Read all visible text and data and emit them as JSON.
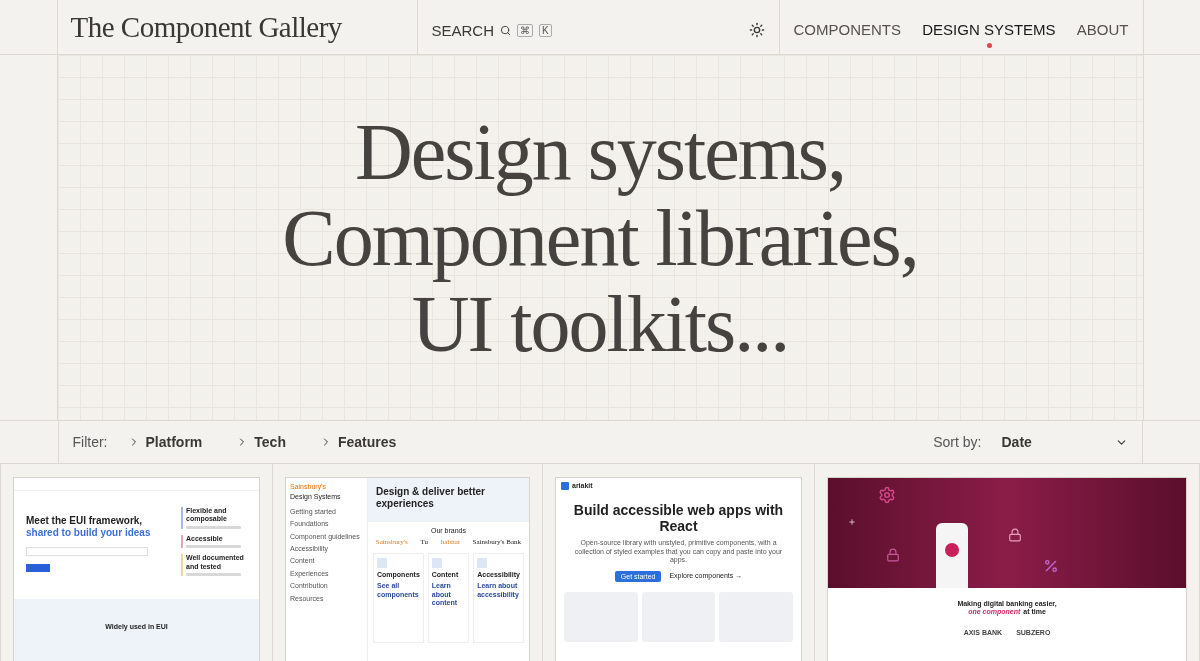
{
  "header": {
    "logo": "The Component Gallery",
    "search": {
      "label": "SEARCH",
      "keys": [
        "⌘",
        "K"
      ]
    },
    "nav": [
      {
        "label": "COMPONENTS",
        "selected": false
      },
      {
        "label": "DESIGN SYSTEMS",
        "selected": true
      },
      {
        "label": "ABOUT",
        "selected": false
      }
    ]
  },
  "hero": {
    "lines": [
      "Design systems,",
      "Component libraries,",
      "UI toolkits..."
    ]
  },
  "filter": {
    "label": "Filter:",
    "options": [
      "Platform",
      "Tech",
      "Features"
    ],
    "sort_label": "Sort by:",
    "sort_value": "Date"
  },
  "cards": [
    {
      "kind": "eui",
      "heading": "Meet the EUI framework,",
      "accent": "shared to build your ideas",
      "features": [
        "Flexible and composable",
        "Accessible",
        "Well documented and tested"
      ],
      "section": "Widely used in EUI"
    },
    {
      "kind": "sainsbury",
      "brand": "Sainsbury's",
      "brand_rest": "Design Systems",
      "nav": [
        "Getting started",
        "Foundations",
        "Component guidelines",
        "Accessibility",
        "Content",
        "Experiences",
        "Contribution",
        "Resources"
      ],
      "heading": "Design & deliver better experiences",
      "brands_title": "Our brands",
      "brands": [
        "Sainsbury's",
        "Tu",
        "habitat",
        "Sainsbury's Bank"
      ],
      "tiles": [
        {
          "title": "Components",
          "link": "See all components"
        },
        {
          "title": "Content",
          "link": "Learn about content"
        },
        {
          "title": "Accessibility",
          "link": "Learn about accessibility"
        }
      ]
    },
    {
      "kind": "ariakit",
      "logo": "ariakit",
      "heading": "Build accessible web apps with React",
      "body": "Open-source library with unstyled, primitive components, with a collection of styled examples that you can copy and paste into your apps.",
      "primary": "Get started",
      "secondary": "Explore components →"
    },
    {
      "kind": "banking",
      "heading": "Making digital banking easier,",
      "accent": "one component",
      "rest": "at time",
      "partners": [
        "AXIS BANK",
        "SUBZERO"
      ]
    }
  ]
}
